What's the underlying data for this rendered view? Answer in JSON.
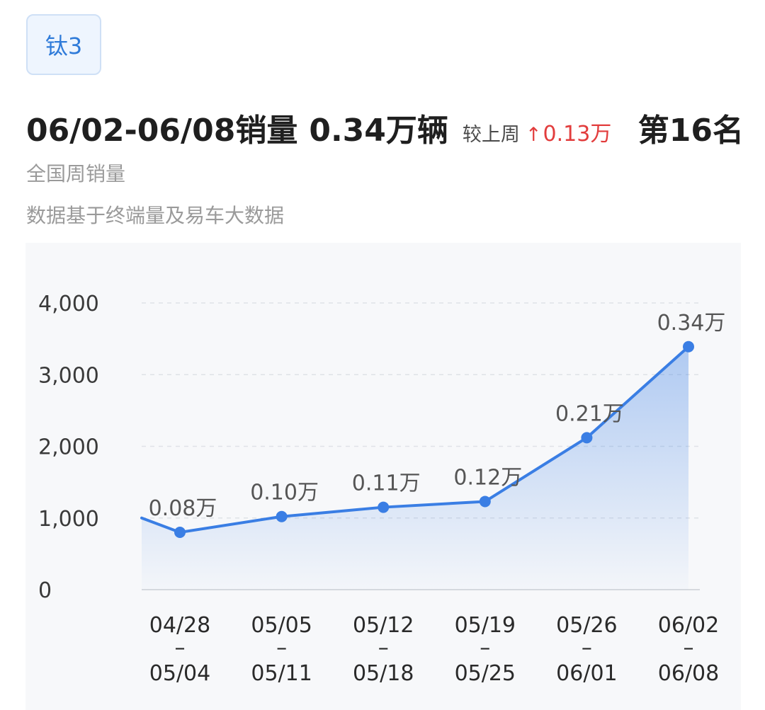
{
  "tag": {
    "label": "钛3"
  },
  "headline": {
    "period_label": "06/02-06/08销量",
    "value": "0.34万辆",
    "compare_label": "较上周",
    "change": "0.13万",
    "rank": "第16名"
  },
  "subtitle": "全国周销量",
  "source_note": "数据基于终端量及易车大数据",
  "colors": {
    "line": "#3a7ee4",
    "increase": "#e23d3d",
    "tag_text": "#2f7bd9"
  },
  "chart_data": {
    "type": "area",
    "title": "",
    "xlabel": "",
    "ylabel": "",
    "ylim": [
      0,
      4000
    ],
    "yticks": [
      0,
      1000,
      2000,
      3000,
      4000
    ],
    "ytick_labels": [
      "0",
      "1,000",
      "2,000",
      "3,000",
      "4,000"
    ],
    "grid": true,
    "categories": [
      {
        "start": "04/28",
        "sep": "–",
        "end": "05/04"
      },
      {
        "start": "05/05",
        "sep": "–",
        "end": "05/11"
      },
      {
        "start": "05/12",
        "sep": "–",
        "end": "05/18"
      },
      {
        "start": "05/19",
        "sep": "–",
        "end": "05/25"
      },
      {
        "start": "05/26",
        "sep": "–",
        "end": "06/01"
      },
      {
        "start": "06/02",
        "sep": "–",
        "end": "06/08"
      }
    ],
    "values": [
      800,
      1020,
      1150,
      1230,
      2120,
      3390
    ],
    "data_labels": [
      "0.08万",
      "0.10万",
      "0.11万",
      "0.12万",
      "0.21万",
      "0.34万"
    ],
    "leading_value": 1000
  }
}
